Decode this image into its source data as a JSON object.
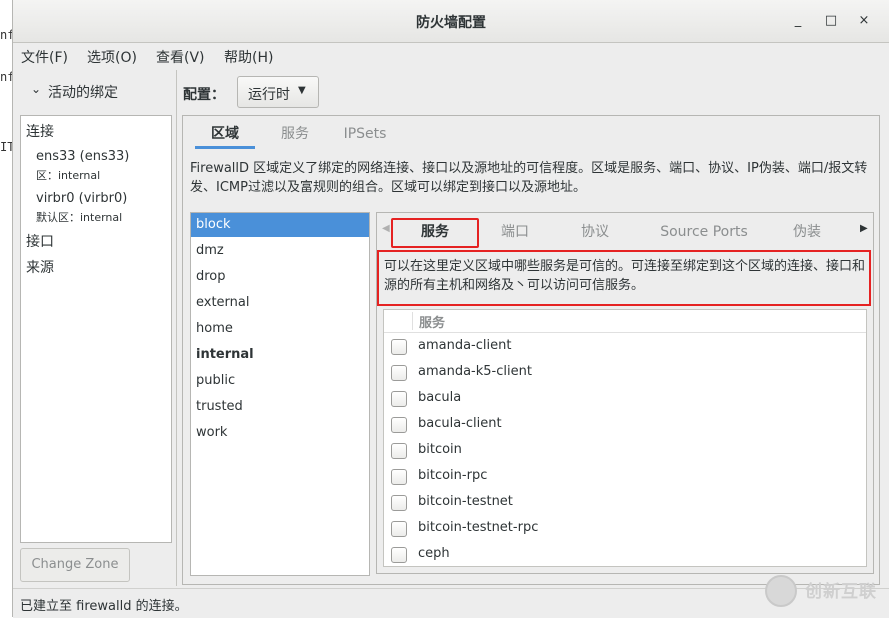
{
  "background_terminal": [
    "nfig",
    "nf",
    "",
    "IT"
  ],
  "window": {
    "title": "防火墙配置",
    "controls": {
      "minimize": "_",
      "maximize": "□",
      "close": "×"
    }
  },
  "menubar": [
    "文件(F)",
    "选项(O)",
    "查看(V)",
    "帮助(H)"
  ],
  "left": {
    "header": "活动的绑定",
    "connections_label": "连接",
    "connections": [
      {
        "name": "ens33 (ens33)",
        "zone": "区：internal"
      },
      {
        "name": "virbr0 (virbr0)",
        "zone": "默认区：internal"
      }
    ],
    "interfaces_label": "接口",
    "sources_label": "来源",
    "change_zone": "Change Zone"
  },
  "config": {
    "label": "配置：",
    "value": "运行时"
  },
  "main_tabs": [
    "区域",
    "服务",
    "IPSets"
  ],
  "zones_description": "FirewallD 区域定义了绑定的网络连接、接口以及源地址的可信程度。区域是服务、端口、协议、IP伪装、端口/报文转发、ICMP过滤以及富规则的组合。区域可以绑定到接口以及源地址。",
  "zones": [
    {
      "name": "block",
      "selected": true,
      "bold": false
    },
    {
      "name": "dmz",
      "selected": false,
      "bold": false
    },
    {
      "name": "drop",
      "selected": false,
      "bold": false
    },
    {
      "name": "external",
      "selected": false,
      "bold": false
    },
    {
      "name": "home",
      "selected": false,
      "bold": false
    },
    {
      "name": "internal",
      "selected": false,
      "bold": true
    },
    {
      "name": "public",
      "selected": false,
      "bold": false
    },
    {
      "name": "trusted",
      "selected": false,
      "bold": false
    },
    {
      "name": "work",
      "selected": false,
      "bold": false
    }
  ],
  "sub_tabs": [
    "服务",
    "端口",
    "协议",
    "Source Ports",
    "伪装"
  ],
  "services_description": "可以在这里定义区域中哪些服务是可信的。可连接至绑定到这个区域的连接、接口和源的所有主机和网络及丶可以访问可信服务。",
  "services_header": "服务",
  "services": [
    "amanda-client",
    "amanda-k5-client",
    "bacula",
    "bacula-client",
    "bitcoin",
    "bitcoin-rpc",
    "bitcoin-testnet",
    "bitcoin-testnet-rpc",
    "ceph"
  ],
  "status": "已建立至 firewalld 的连接。",
  "watermark": "创新互联",
  "colors": {
    "accent": "#4a90d9",
    "highlight_box": "#e52222"
  }
}
